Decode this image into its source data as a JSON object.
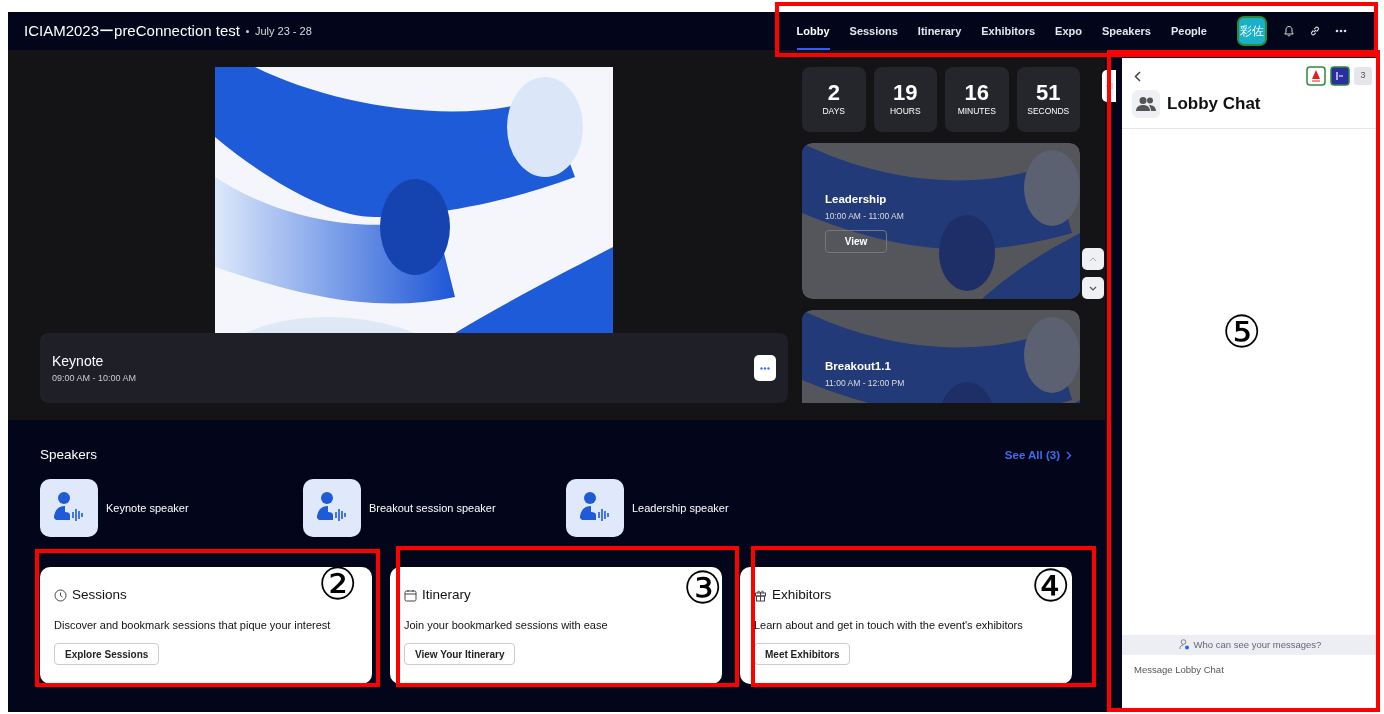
{
  "event": {
    "title": "ICIAM2023ーpreConnection test",
    "dates": "July 23 - 28"
  },
  "nav": {
    "tabs": [
      {
        "label": "Lobby",
        "selected": true
      },
      {
        "label": "Sessions",
        "selected": false
      },
      {
        "label": "Itinerary",
        "selected": false
      },
      {
        "label": "Exhibitors",
        "selected": false
      },
      {
        "label": "Expo",
        "selected": false
      },
      {
        "label": "Speakers",
        "selected": false
      },
      {
        "label": "People",
        "selected": false
      }
    ],
    "avatar": "彩佐"
  },
  "player": {
    "title": "Keynote",
    "time": "09:00 AM - 10:00 AM"
  },
  "countdown": [
    {
      "value": "2",
      "unit": "DAYS"
    },
    {
      "value": "19",
      "unit": "HOURS"
    },
    {
      "value": "16",
      "unit": "MINUTES"
    },
    {
      "value": "51",
      "unit": "SECONDS"
    }
  ],
  "sessions": [
    {
      "title": "Leadership",
      "time": "10:00 AM - 11:00 AM",
      "button": "View"
    },
    {
      "title": "Breakout1.1",
      "time": "11:00 AM - 12:00 PM"
    }
  ],
  "speakers": {
    "heading": "Speakers",
    "see_all": "See All (3)",
    "items": [
      {
        "name": "Keynote speaker"
      },
      {
        "name": "Breakout session speaker"
      },
      {
        "name": "Leadership speaker"
      }
    ]
  },
  "feature_cards": [
    {
      "kind": "clock",
      "title": "Sessions",
      "description": "Discover and bookmark sessions that pique your interest",
      "button": "Explore Sessions"
    },
    {
      "kind": "calendar",
      "title": "Itinerary",
      "description": "Join your bookmarked sessions with ease",
      "button": "View Your Itinerary"
    },
    {
      "kind": "gift",
      "title": "Exhibitors",
      "description": "Learn about and get in touch with the event's exhibitors",
      "button": "Meet Exhibitors"
    }
  ],
  "chat": {
    "title": "Lobby Chat",
    "participant_count": "3",
    "notice": "Who can see your messages?",
    "placeholder": "Message Lobby Chat"
  },
  "annotations": [
    {
      "label": "②"
    },
    {
      "label": "③"
    },
    {
      "label": "④"
    },
    {
      "label": "⑤"
    }
  ]
}
